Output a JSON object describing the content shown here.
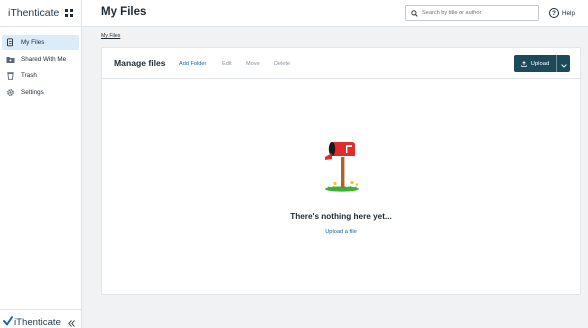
{
  "app": {
    "brand": "iThenticate",
    "footer_brand": "iThenticate"
  },
  "colors": {
    "accent": "#1565b0",
    "primary_button": "#1d4a5b",
    "active_nav_bg": "#dcebf8",
    "mailbox_red": "#e22b2b"
  },
  "sidebar": {
    "items": [
      {
        "label": "My Files",
        "icon": "files-icon",
        "active": true
      },
      {
        "label": "Shared With Me",
        "icon": "shared-folder-icon",
        "active": false
      },
      {
        "label": "Trash",
        "icon": "trash-icon",
        "active": false
      },
      {
        "label": "Settings",
        "icon": "gear-icon",
        "active": false
      }
    ]
  },
  "header": {
    "title": "My Files",
    "search_placeholder": "Search by title or author",
    "help_label": "Help"
  },
  "breadcrumb": "My Files",
  "card": {
    "title": "Manage files",
    "actions": [
      {
        "label": "Add Folder",
        "enabled": true
      },
      {
        "label": "Edit",
        "enabled": false
      },
      {
        "label": "Move",
        "enabled": false
      },
      {
        "label": "Delete",
        "enabled": false
      }
    ],
    "upload_label": "Upload",
    "empty_title": "There's nothing here yet...",
    "empty_link": "Upload a file"
  }
}
